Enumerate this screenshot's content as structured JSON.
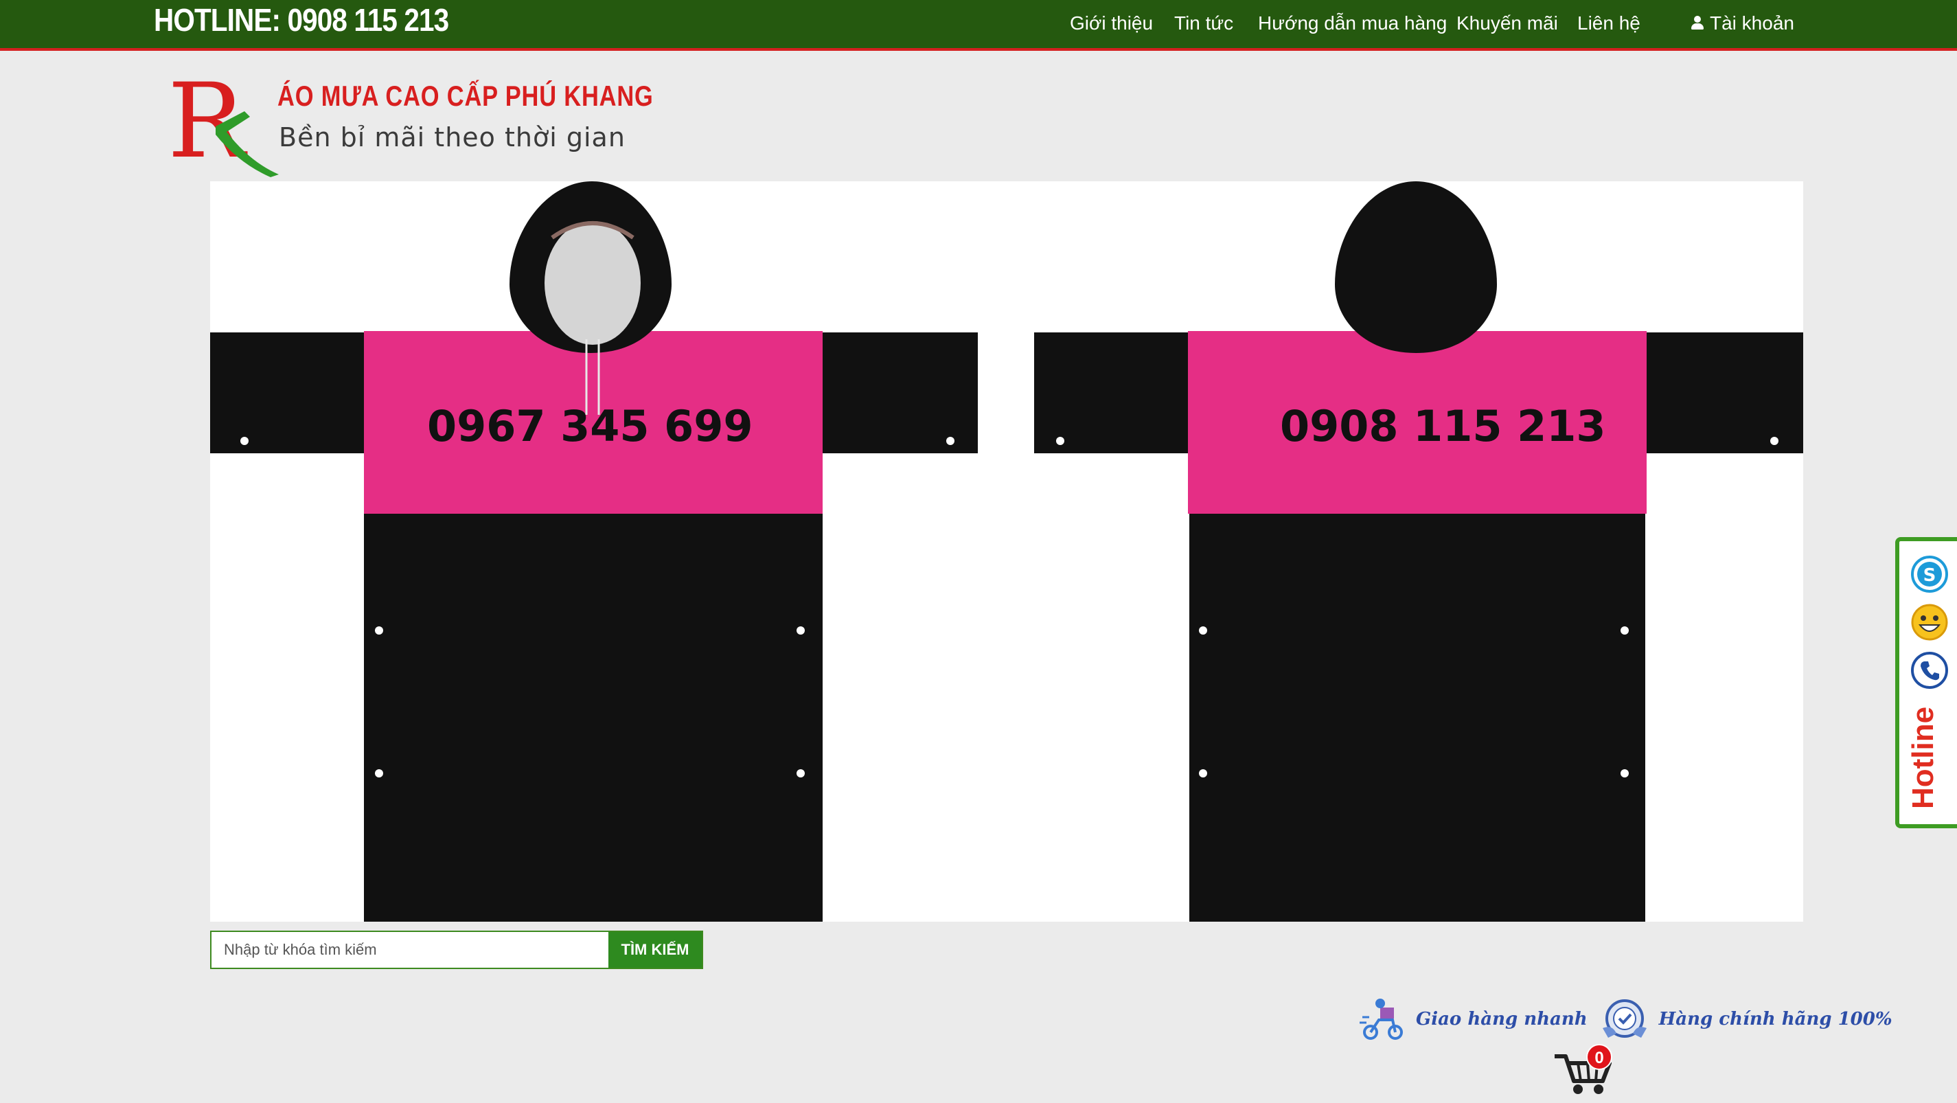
{
  "header": {
    "hotline": "HOTLINE: 0908 115 213",
    "nav": [
      "Giới thiệu",
      "Tin tức",
      "Hướng dẫn mua hàng",
      "Khuyến mãi",
      "Liên hệ"
    ],
    "account": "Tài khoản"
  },
  "logo": {
    "title": "ÁO MƯA CAO CẤP PHÚ KHANG",
    "slogan": "Bền bỉ mãi theo thời gian"
  },
  "banner": {
    "front_phone": "0967 345 699",
    "back_phone": "0908 115 213",
    "colors": {
      "body": "#111111",
      "chest": "#e52e85",
      "background": "#ffffff"
    }
  },
  "search": {
    "placeholder": "Nhập từ khóa tìm kiếm",
    "button": "TÌM KIẾM"
  },
  "features": [
    {
      "icon": "delivery-icon",
      "label": "Giao hàng nhanh"
    },
    {
      "icon": "quality-badge-icon",
      "label": "Hàng chính hãng 100%"
    }
  ],
  "cart": {
    "count": "0"
  },
  "sidebar": {
    "icons": [
      "skype-icon",
      "yahoo-messenger-icon",
      "phone-icon"
    ],
    "label": "Hotline"
  }
}
